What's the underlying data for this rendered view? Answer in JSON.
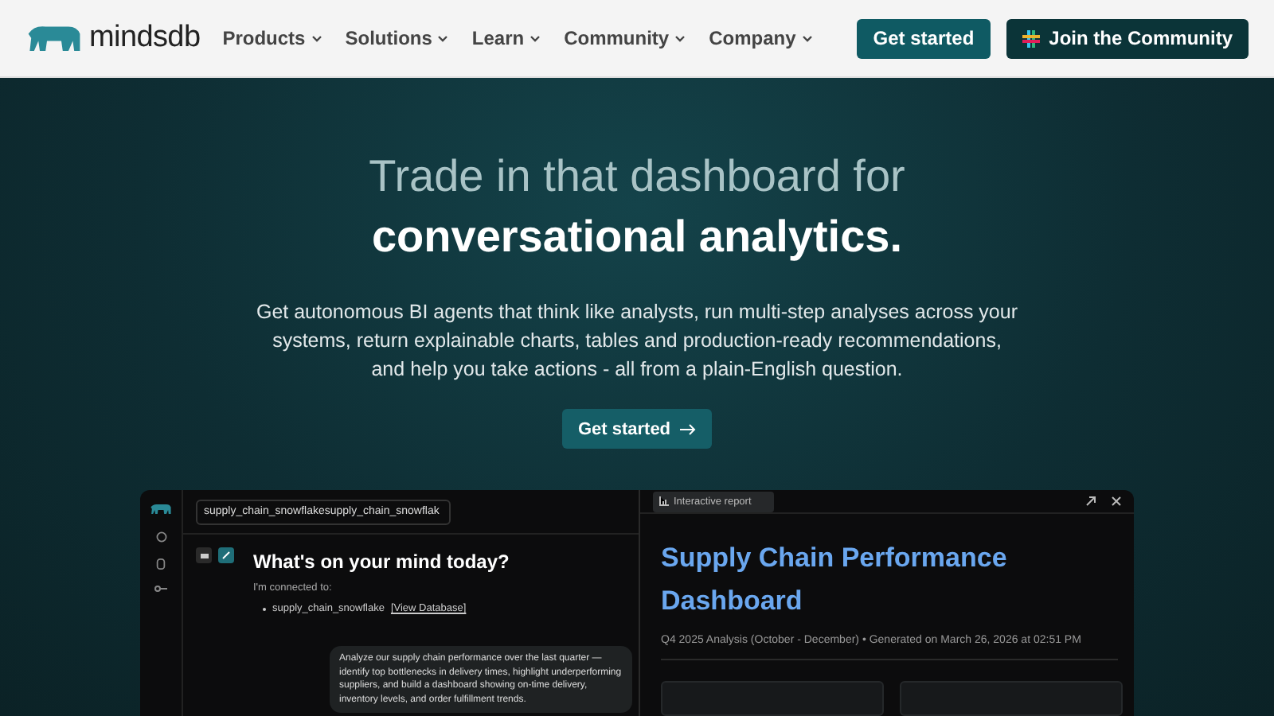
{
  "brand": "mindsdb",
  "nav": [
    {
      "label": "Products"
    },
    {
      "label": "Solutions"
    },
    {
      "label": "Learn"
    },
    {
      "label": "Community"
    },
    {
      "label": "Company"
    }
  ],
  "nav_buttons": [
    {
      "label": "Get started",
      "kind": "primary"
    },
    {
      "label": "Join the Community",
      "kind": "community"
    }
  ],
  "hero": {
    "title_light": "Trade in that dashboard for",
    "title_bold": "conversational analytics.",
    "text": "Get autonomous BI agents that think like analysts, run multi-step analyses across your systems, return explainable charts, tables and production-ready recommendations, and help you take actions -  all from a plain-English question.",
    "button": "Get started"
  },
  "app": {
    "source_field": "supply_chain_snowflakesupply_chain_snowflak",
    "heading": "What's on your mind today?",
    "connected_label": "I'm connected to:",
    "connection": "supply_chain_snowflake",
    "connection_link": "[View Database]",
    "message": "Analyze our supply chain performance over the last quarter — identify top bottlenecks in delivery times, highlight underperforming suppliers, and build a dashboard showing on-time delivery, inventory levels, and order fulfillment trends.",
    "report_tab": "Interactive report",
    "report_title": "Supply Chain Performance Dashboard",
    "report_subtitle": "Q4 2025 Analysis (October - December) • Generated on March 26, 2026 at 02:51 PM"
  }
}
